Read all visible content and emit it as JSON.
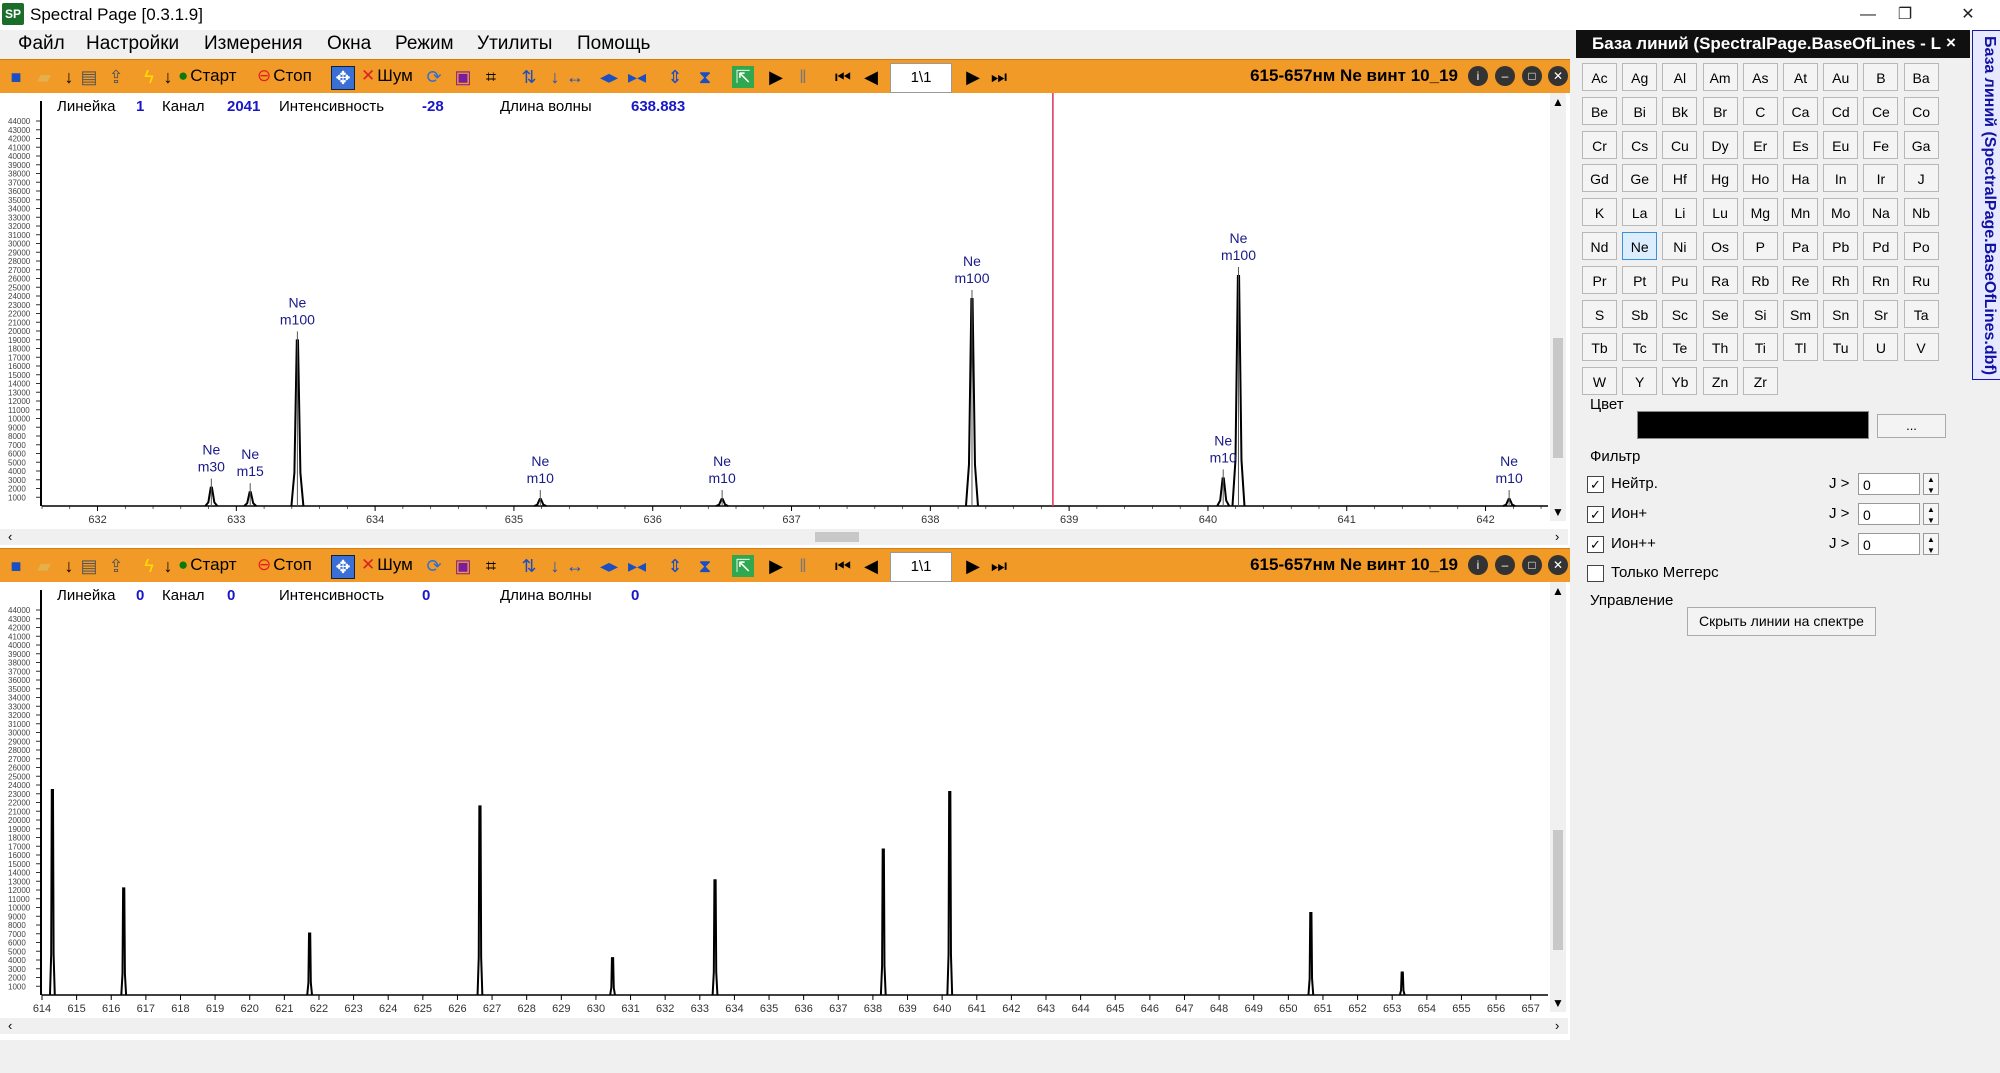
{
  "window": {
    "app_abbr": "SP",
    "title": "Spectral Page [0.3.1.9]",
    "min": "—",
    "restore": "❐",
    "close": "✕"
  },
  "menu": [
    "Файл",
    "Настройки",
    "Измерения",
    "Окна",
    "Режим",
    "Утилиты",
    "Помощь"
  ],
  "toolbar": {
    "start": "Старт",
    "stop": "Стоп",
    "noise": "Шум",
    "frame": "1\\1",
    "spectrum_title": "615-657нм Ne винт 10_19"
  },
  "panel_top": {
    "labels": {
      "line": "Линейка",
      "channel": "Канал",
      "intensity": "Интенсивность",
      "wavelength": "Длина волны"
    },
    "values": {
      "line": "1",
      "channel": "2041",
      "intensity": "-28",
      "wavelength": "638.883"
    },
    "cursor_wavelength": 638.883,
    "peak_labels": [
      {
        "element": "Ne",
        "mult": "m30",
        "wl": 632.82
      },
      {
        "element": "Ne",
        "mult": "m15",
        "wl": 633.1
      },
      {
        "element": "Ne",
        "mult": "m100",
        "wl": 633.44
      },
      {
        "element": "Ne",
        "mult": "m10",
        "wl": 635.19
      },
      {
        "element": "Ne",
        "mult": "m10",
        "wl": 636.5
      },
      {
        "element": "Ne",
        "mult": "m100",
        "wl": 638.3
      },
      {
        "element": "Ne",
        "mult": "m10",
        "wl": 640.11
      },
      {
        "element": "Ne",
        "mult": "m100",
        "wl": 640.22
      },
      {
        "element": "Ne",
        "mult": "m10",
        "wl": 642.17
      }
    ],
    "x_ticks": [
      "632",
      "633",
      "634",
      "635",
      "636",
      "637",
      "638",
      "639",
      "640",
      "641",
      "642"
    ]
  },
  "panel_bottom": {
    "labels": {
      "line": "Линейка",
      "channel": "Канал",
      "intensity": "Интенсивность",
      "wavelength": "Длина волны"
    },
    "values": {
      "line": "0",
      "channel": "0",
      "intensity": "0",
      "wavelength": "0"
    },
    "x_ticks": [
      "614",
      "615",
      "616",
      "617",
      "618",
      "619",
      "620",
      "621",
      "622",
      "623",
      "624",
      "625",
      "626",
      "627",
      "628",
      "629",
      "630",
      "631",
      "632",
      "633",
      "634",
      "635",
      "636",
      "637",
      "638",
      "639",
      "640",
      "641",
      "642",
      "643",
      "644",
      "645",
      "646",
      "647",
      "648",
      "649",
      "650",
      "651",
      "652",
      "653",
      "654",
      "655",
      "656",
      "657"
    ]
  },
  "chart_data": [
    {
      "type": "line",
      "xlim": [
        631.6,
        642.45
      ],
      "x_label_ticks": [
        632,
        633,
        634,
        635,
        636,
        637,
        638,
        639,
        640,
        641,
        642
      ],
      "peaks": [
        {
          "x": 632.82,
          "rel": 0.08
        },
        {
          "x": 633.1,
          "rel": 0.06
        },
        {
          "x": 633.44,
          "rel": 0.72
        },
        {
          "x": 635.19,
          "rel": 0.03
        },
        {
          "x": 636.5,
          "rel": 0.03
        },
        {
          "x": 638.3,
          "rel": 0.9
        },
        {
          "x": 640.11,
          "rel": 0.12
        },
        {
          "x": 640.22,
          "rel": 1.0
        },
        {
          "x": 642.17,
          "rel": 0.03
        }
      ]
    },
    {
      "type": "line",
      "xlim": [
        614,
        657.5
      ],
      "x_label_ticks": [
        614,
        615,
        616,
        617,
        618,
        619,
        620,
        621,
        622,
        623,
        624,
        625,
        626,
        627,
        628,
        629,
        630,
        631,
        632,
        633,
        634,
        635,
        636,
        637,
        638,
        639,
        640,
        641,
        642,
        643,
        644,
        645,
        646,
        647,
        648,
        649,
        650,
        651,
        652,
        653,
        654,
        655,
        656,
        657
      ],
      "peaks": [
        {
          "x": 614.3,
          "rel": 1.0
        },
        {
          "x": 616.36,
          "rel": 0.52
        },
        {
          "x": 621.73,
          "rel": 0.3
        },
        {
          "x": 626.65,
          "rel": 0.92
        },
        {
          "x": 630.48,
          "rel": 0.18
        },
        {
          "x": 633.44,
          "rel": 0.56
        },
        {
          "x": 638.3,
          "rel": 0.71
        },
        {
          "x": 640.22,
          "rel": 0.99
        },
        {
          "x": 650.65,
          "rel": 0.4
        },
        {
          "x": 653.29,
          "rel": 0.11
        }
      ]
    }
  ],
  "y_ticks": [
    "1000",
    "2000",
    "3000",
    "4000",
    "5000",
    "6000",
    "7000",
    "8000",
    "9000",
    "10000",
    "11000",
    "12000",
    "13000",
    "14000",
    "15000",
    "16000",
    "17000",
    "18000",
    "19000",
    "20000",
    "21000",
    "22000",
    "23000",
    "24000",
    "25000",
    "26000",
    "27000",
    "28000",
    "29000",
    "30000",
    "31000",
    "32000",
    "33000",
    "34000",
    "35000",
    "36000",
    "37000",
    "38000",
    "39000",
    "40000",
    "41000",
    "42000",
    "43000",
    "44000"
  ],
  "lines_db": {
    "title": "База линий (SpectralPage.BaseOfLines - L",
    "close": "×",
    "elements": [
      "Ac",
      "Ag",
      "Al",
      "Am",
      "As",
      "At",
      "Au",
      "B",
      "Ba",
      "Be",
      "Bi",
      "Bk",
      "Br",
      "C",
      "Ca",
      "Cd",
      "Ce",
      "Co",
      "Cr",
      "Cs",
      "Cu",
      "Dy",
      "Er",
      "Es",
      "Eu",
      "Fe",
      "Ga",
      "Gd",
      "Ge",
      "Hf",
      "Hg",
      "Ho",
      "Ha",
      "In",
      "Ir",
      "J",
      "K",
      "La",
      "Li",
      "Lu",
      "Mg",
      "Mn",
      "Mo",
      "Na",
      "Nb",
      "Nd",
      "Ne",
      "Ni",
      "Os",
      "P",
      "Pa",
      "Pb",
      "Pd",
      "Po",
      "Pr",
      "Pt",
      "Pu",
      "Ra",
      "Rb",
      "Re",
      "Rh",
      "Rn",
      "Ru",
      "S",
      "Sb",
      "Sc",
      "Se",
      "Si",
      "Sm",
      "Sn",
      "Sr",
      "Ta",
      "Tb",
      "Tc",
      "Te",
      "Th",
      "Ti",
      "Tl",
      "Tu",
      "U",
      "V",
      "W",
      "Y",
      "Yb",
      "Zn",
      "Zr"
    ],
    "selected": "Ne",
    "color_label": "Цвет",
    "color_value": "#000000",
    "color_btn": "...",
    "filter_label": "Фильтр",
    "filters": [
      {
        "label": "Нейтр.",
        "checked": true,
        "cond": "J >",
        "value": "0"
      },
      {
        "label": "Ион+",
        "checked": true,
        "cond": "J >",
        "value": "0"
      },
      {
        "label": "Ион++",
        "checked": true,
        "cond": "J >",
        "value": "0"
      }
    ],
    "megger_label": "Только Меггерс",
    "megger_checked": false,
    "control_label": "Управление",
    "hide_lines_btn": "Скрыть линии на спектре",
    "side_tab": "База линий (SpectralPage.BaseOfLines.dbf)"
  }
}
